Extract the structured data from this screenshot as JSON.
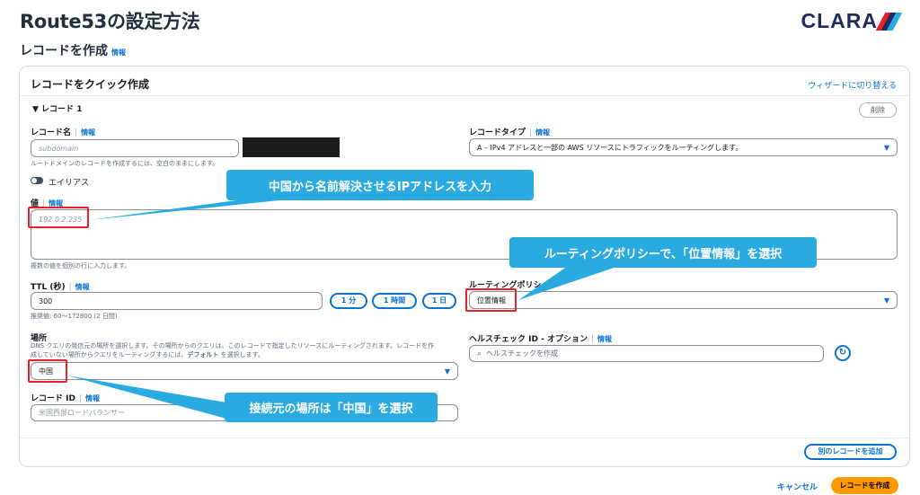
{
  "page": {
    "title": "Route53の設定方法",
    "logo": "CLARA",
    "logo_colors": [
      "#e8202a",
      "#1e2b5c",
      "#29abe2"
    ],
    "section_title": "レコードを作成",
    "info_label": "情報"
  },
  "card": {
    "title": "レコードをクイック作成",
    "wizard_link": "ウィザードに切り替える",
    "record_toggle": "▼ レコード 1",
    "delete_button": "削除"
  },
  "fields": {
    "record_name": {
      "label": "レコード名",
      "placeholder": "subdomain",
      "hint": "ルートドメインのレコードを作成するには、空白のままにします。"
    },
    "record_type": {
      "label": "レコードタイプ",
      "value": "A – IPv4 アドレスと一部の AWS リソースにトラフィックをルーティングします。"
    },
    "alias": {
      "label": "エイリアス"
    },
    "value": {
      "label": "値",
      "placeholder": "192.0.2.235",
      "hint": "複数の値を個別の行に入力します。"
    },
    "ttl": {
      "label": "TTL (秒)",
      "value": "300",
      "hint": "推奨値: 60～172800 (2 日間)",
      "buttons": [
        "1 分",
        "1 時間",
        "1 日"
      ]
    },
    "routing_policy": {
      "label": "ルーティングポリシー",
      "value": "位置情報"
    },
    "location": {
      "label": "場所",
      "hint_line1": "DNS クエリの発信元の場所を選択します。その場所からのクエリは、このレコードで指定したリソースにルーティングされます。レコードを作",
      "hint_line2_a": "成していない場所からクエリをルーティングするには、",
      "hint_line2_b": "デフォルト",
      "hint_line2_c": " を選択します。",
      "value": "中国"
    },
    "health_check": {
      "label": "ヘルスチェック ID - オプション",
      "placeholder": "ヘルスチェックを作成"
    },
    "record_id": {
      "label": "レコード ID",
      "placeholder": "米国西部ロードバランサー"
    }
  },
  "footer": {
    "add_record": "別のレコードを追加",
    "cancel": "キャンセル",
    "create": "レコードを作成"
  },
  "annotations": {
    "callout_ip": "中国から名前解決させるIPアドレスを入力",
    "callout_policy": "ルーティングポリシーで、「位置情報」を選択",
    "callout_location": "接続元の場所は「中国」を選択",
    "callout_color": "#29abe2",
    "highlight_color": "#e8202a"
  }
}
